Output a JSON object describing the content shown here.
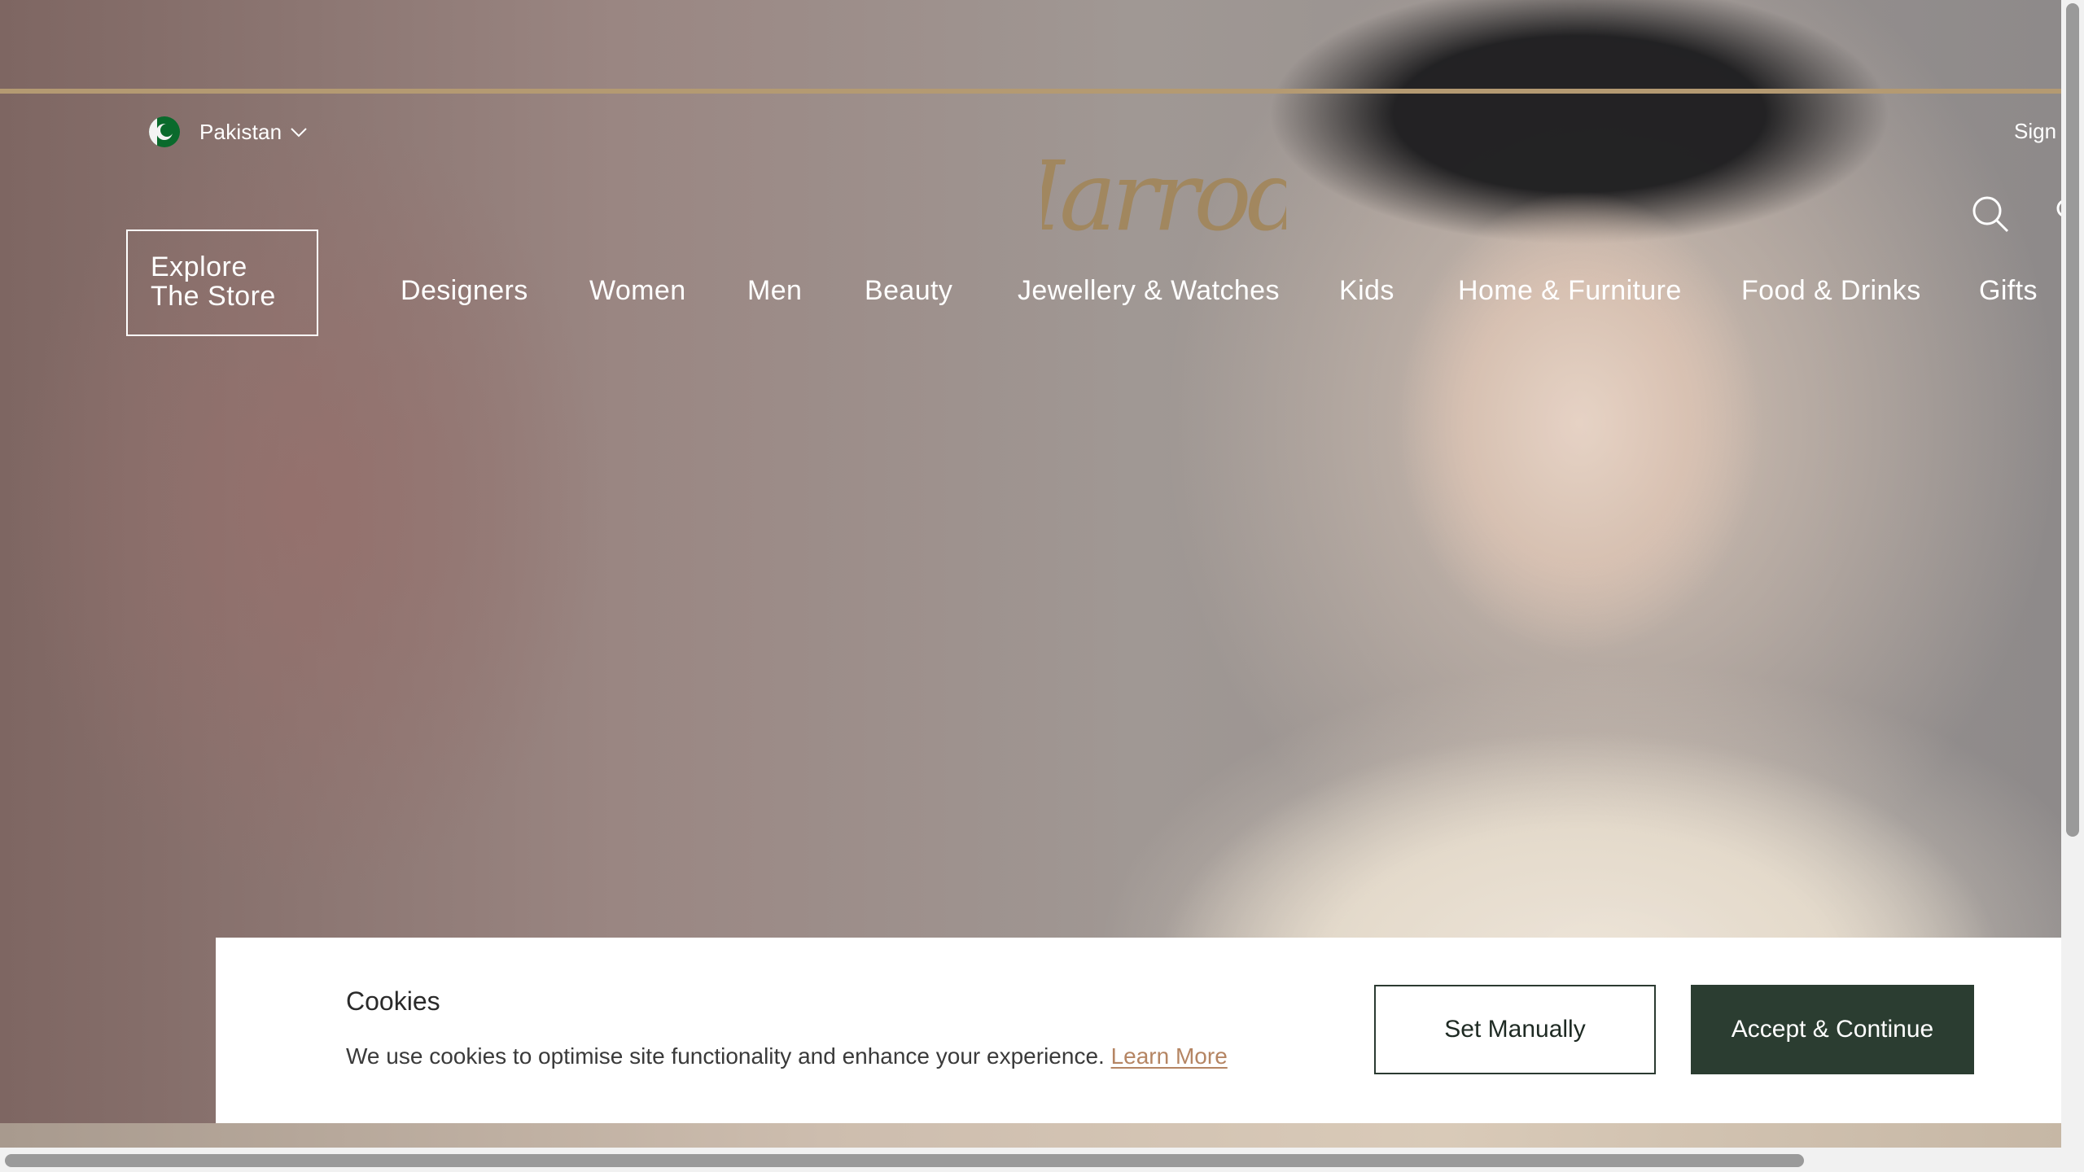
{
  "header": {
    "country": "Pakistan",
    "sign_in": "Sign i",
    "brand": "Harrods",
    "explore_line1": "Explore",
    "explore_line2": "The Store"
  },
  "nav": {
    "items": [
      "Designers",
      "Women",
      "Men",
      "Beauty",
      "Jewellery & Watches",
      "Kids",
      "Home & Furniture",
      "Food & Drinks",
      "Gifts"
    ]
  },
  "cookie": {
    "title": "Cookies",
    "text": "We use cookies to optimise site functionality and enhance your experience.",
    "link": "Learn More",
    "set_manually": "Set Manually",
    "accept": "Accept & Continue"
  },
  "colors": {
    "brand_gold": "#b49a72",
    "accept_green": "#2b3d31",
    "link_copper": "#b58563"
  },
  "icons": {
    "search": "search-icon",
    "country_dropdown": "chevron-down-icon",
    "flag": "pakistan-flag-icon"
  }
}
